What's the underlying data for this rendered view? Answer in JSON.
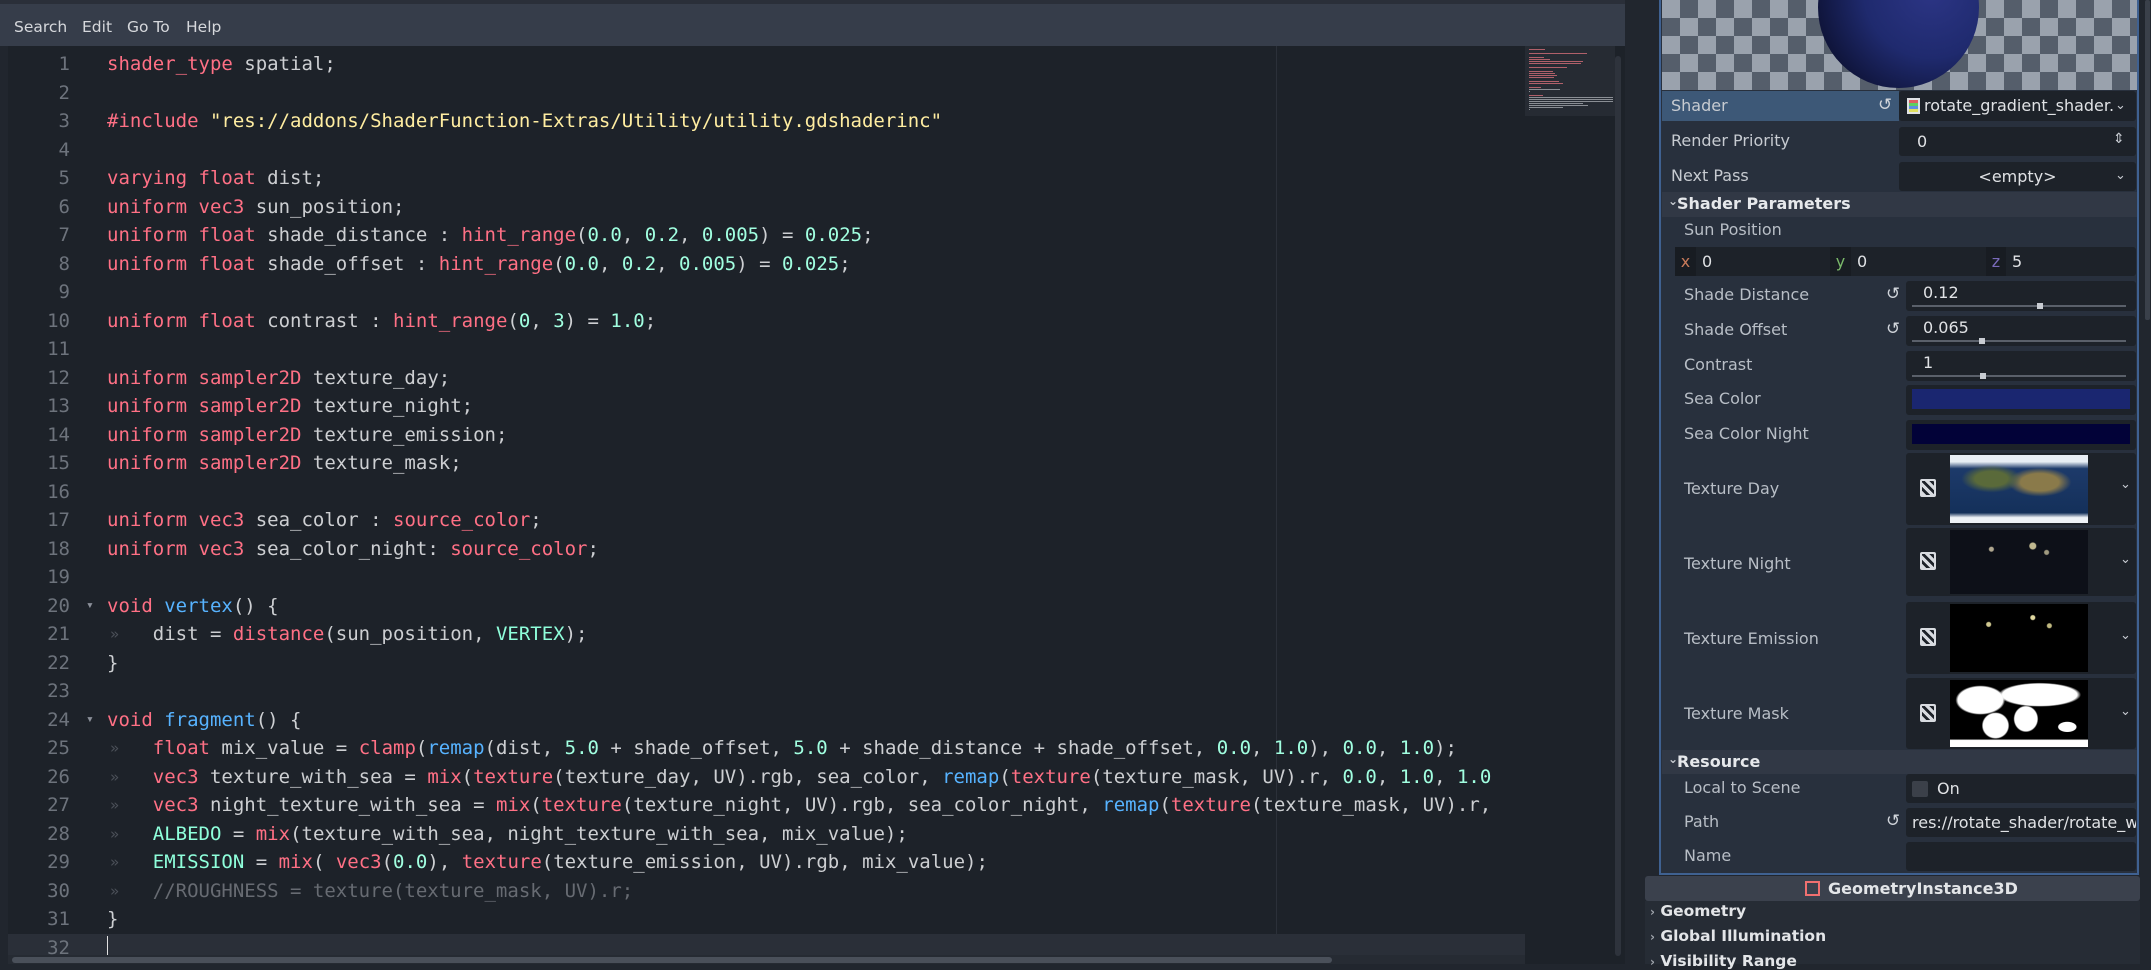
{
  "menu": [
    "Search",
    "Edit",
    "Go To",
    "Help"
  ],
  "editor": {
    "current_line": 32,
    "lines": [
      [
        [
          "shader_type",
          "kw"
        ],
        [
          " spatial;",
          ""
        ]
      ],
      [],
      [
        [
          "#include",
          "kw"
        ],
        [
          " ",
          ""
        ],
        [
          "\"res://addons/ShaderFunction-Extras/Utility/utility.gdshaderinc\"",
          "str"
        ]
      ],
      [],
      [
        [
          "varying",
          "kw"
        ],
        [
          " ",
          ""
        ],
        [
          "float",
          "kw"
        ],
        [
          " dist;",
          ""
        ]
      ],
      [
        [
          "uniform",
          "kw"
        ],
        [
          " ",
          ""
        ],
        [
          "vec3",
          "kw"
        ],
        [
          " sun_position;",
          ""
        ]
      ],
      [
        [
          "uniform",
          "kw"
        ],
        [
          " ",
          ""
        ],
        [
          "float",
          "kw"
        ],
        [
          " shade_distance : ",
          ""
        ],
        [
          "hint_range",
          "kw"
        ],
        [
          "(",
          ""
        ],
        [
          "0.0",
          "num"
        ],
        [
          ", ",
          ""
        ],
        [
          "0.2",
          "num"
        ],
        [
          ", ",
          ""
        ],
        [
          "0.005",
          "num"
        ],
        [
          ") = ",
          ""
        ],
        [
          "0.025",
          "num"
        ],
        [
          ";",
          ""
        ]
      ],
      [
        [
          "uniform",
          "kw"
        ],
        [
          " ",
          ""
        ],
        [
          "float",
          "kw"
        ],
        [
          " shade_offset : ",
          ""
        ],
        [
          "hint_range",
          "kw"
        ],
        [
          "(",
          ""
        ],
        [
          "0.0",
          "num"
        ],
        [
          ", ",
          ""
        ],
        [
          "0.2",
          "num"
        ],
        [
          ", ",
          ""
        ],
        [
          "0.005",
          "num"
        ],
        [
          ") = ",
          ""
        ],
        [
          "0.025",
          "num"
        ],
        [
          ";",
          ""
        ]
      ],
      [],
      [
        [
          "uniform",
          "kw"
        ],
        [
          " ",
          ""
        ],
        [
          "float",
          "kw"
        ],
        [
          " contrast : ",
          ""
        ],
        [
          "hint_range",
          "kw"
        ],
        [
          "(",
          ""
        ],
        [
          "0",
          "num"
        ],
        [
          ", ",
          ""
        ],
        [
          "3",
          "num"
        ],
        [
          ") = ",
          ""
        ],
        [
          "1.0",
          "num"
        ],
        [
          ";",
          ""
        ]
      ],
      [],
      [
        [
          "uniform",
          "kw"
        ],
        [
          " ",
          ""
        ],
        [
          "sampler2D",
          "kw"
        ],
        [
          " texture_day;",
          ""
        ]
      ],
      [
        [
          "uniform",
          "kw"
        ],
        [
          " ",
          ""
        ],
        [
          "sampler2D",
          "kw"
        ],
        [
          " texture_night;",
          ""
        ]
      ],
      [
        [
          "uniform",
          "kw"
        ],
        [
          " ",
          ""
        ],
        [
          "sampler2D",
          "kw"
        ],
        [
          " texture_emission;",
          ""
        ]
      ],
      [
        [
          "uniform",
          "kw"
        ],
        [
          " ",
          ""
        ],
        [
          "sampler2D",
          "kw"
        ],
        [
          " texture_mask;",
          ""
        ]
      ],
      [],
      [
        [
          "uniform",
          "kw"
        ],
        [
          " ",
          ""
        ],
        [
          "vec3",
          "kw"
        ],
        [
          " sea_color : ",
          ""
        ],
        [
          "source_color",
          "kw"
        ],
        [
          ";",
          ""
        ]
      ],
      [
        [
          "uniform",
          "kw"
        ],
        [
          " ",
          ""
        ],
        [
          "vec3",
          "kw"
        ],
        [
          " sea_color_night: ",
          ""
        ],
        [
          "source_color",
          "kw"
        ],
        [
          ";",
          ""
        ]
      ],
      [],
      [
        [
          "void",
          "kw"
        ],
        [
          " ",
          ""
        ],
        [
          "vertex",
          "fn"
        ],
        [
          "() {",
          ""
        ]
      ],
      [
        [
          "\t",
          ""
        ],
        [
          "dist = ",
          ""
        ],
        [
          "distance",
          "kw"
        ],
        [
          "(sun_position, ",
          ""
        ],
        [
          "VERTEX",
          "bi"
        ],
        [
          ");",
          ""
        ]
      ],
      [
        [
          "}",
          ""
        ]
      ],
      [],
      [
        [
          "void",
          "kw"
        ],
        [
          " ",
          ""
        ],
        [
          "fragment",
          "fn"
        ],
        [
          "() {",
          ""
        ]
      ],
      [
        [
          "\t",
          ""
        ],
        [
          "float",
          "kw"
        ],
        [
          " mix_value = ",
          ""
        ],
        [
          "clamp",
          "kw"
        ],
        [
          "(",
          ""
        ],
        [
          "remap",
          "fn"
        ],
        [
          "(dist, ",
          ""
        ],
        [
          "5.0",
          "num"
        ],
        [
          " + shade_offset, ",
          ""
        ],
        [
          "5.0",
          "num"
        ],
        [
          " + shade_distance + shade_offset, ",
          ""
        ],
        [
          "0.0",
          "num"
        ],
        [
          ", ",
          ""
        ],
        [
          "1.0",
          "num"
        ],
        [
          "), ",
          ""
        ],
        [
          "0.0",
          "num"
        ],
        [
          ", ",
          ""
        ],
        [
          "1.0",
          "num"
        ],
        [
          ");",
          ""
        ]
      ],
      [
        [
          "\t",
          ""
        ],
        [
          "vec3",
          "kw"
        ],
        [
          " texture_with_sea = ",
          ""
        ],
        [
          "mix",
          "kw"
        ],
        [
          "(",
          ""
        ],
        [
          "texture",
          "kw"
        ],
        [
          "(texture_day, UV).rgb, sea_color, ",
          ""
        ],
        [
          "remap",
          "fn"
        ],
        [
          "(",
          ""
        ],
        [
          "texture",
          "kw"
        ],
        [
          "(texture_mask, UV).r, ",
          ""
        ],
        [
          "0.0",
          "num"
        ],
        [
          ", ",
          ""
        ],
        [
          "1.0",
          "num"
        ],
        [
          ", ",
          ""
        ],
        [
          "1.0",
          "num"
        ]
      ],
      [
        [
          "\t",
          ""
        ],
        [
          "vec3",
          "kw"
        ],
        [
          " night_texture_with_sea = ",
          ""
        ],
        [
          "mix",
          "kw"
        ],
        [
          "(",
          ""
        ],
        [
          "texture",
          "kw"
        ],
        [
          "(texture_night, UV).rgb, sea_color_night, ",
          ""
        ],
        [
          "remap",
          "fn"
        ],
        [
          "(",
          ""
        ],
        [
          "texture",
          "kw"
        ],
        [
          "(texture_mask, UV).r,",
          ""
        ]
      ],
      [
        [
          "\t",
          ""
        ],
        [
          "ALBEDO",
          "bi"
        ],
        [
          " = ",
          ""
        ],
        [
          "mix",
          "kw"
        ],
        [
          "(texture_with_sea, night_texture_with_sea, mix_value);",
          ""
        ]
      ],
      [
        [
          "\t",
          ""
        ],
        [
          "EMISSION",
          "bi"
        ],
        [
          " = ",
          ""
        ],
        [
          "mix",
          "kw"
        ],
        [
          "( ",
          ""
        ],
        [
          "vec3",
          "kw"
        ],
        [
          "(",
          ""
        ],
        [
          "0.0",
          "num"
        ],
        [
          "), ",
          ""
        ],
        [
          "texture",
          "kw"
        ],
        [
          "(texture_emission, UV).rgb, mix_value);",
          ""
        ]
      ],
      [
        [
          "\t",
          ""
        ],
        [
          "//ROUGHNESS = texture(texture_mask, UV).r;",
          "com"
        ]
      ],
      [
        [
          "}",
          ""
        ]
      ],
      []
    ],
    "foldable_lines": [
      20,
      24
    ]
  },
  "inspector": {
    "shader": {
      "label": "Shader",
      "value": "rotate_gradient_shader."
    },
    "render_priority": {
      "label": "Render Priority",
      "value": "0"
    },
    "next_pass": {
      "label": "Next Pass",
      "value": "<empty>"
    },
    "shader_parameters": {
      "title": "Shader Parameters",
      "sun_position": {
        "label": "Sun Position",
        "x": "0",
        "y": "0",
        "z": "5",
        "x_label": "x",
        "y_label": "y",
        "z_label": "z"
      },
      "shade_distance": {
        "label": "Shade Distance",
        "value": "0.12",
        "fraction": 0.6
      },
      "shade_offset": {
        "label": "Shade Offset",
        "value": "0.065",
        "fraction": 0.325
      },
      "contrast": {
        "label": "Contrast",
        "value": "1",
        "fraction": 0.333
      },
      "sea_color": {
        "label": "Sea Color",
        "color": "#1a2670"
      },
      "sea_color_night": {
        "label": "Sea Color Night",
        "color": "#020238"
      },
      "texture_day": {
        "label": "Texture Day"
      },
      "texture_night": {
        "label": "Texture Night"
      },
      "texture_emission": {
        "label": "Texture Emission"
      },
      "texture_mask": {
        "label": "Texture Mask"
      }
    },
    "resource": {
      "title": "Resource",
      "local_to_scene": {
        "label": "Local to Scene",
        "value": "On",
        "checked": false
      },
      "path": {
        "label": "Path",
        "value": "res://rotate_shader/rotate_w"
      },
      "name": {
        "label": "Name",
        "value": ""
      }
    },
    "geometry_instance": {
      "title": "GeometryInstance3D",
      "sections": [
        "Geometry",
        "Global Illumination",
        "Visibility Range"
      ]
    }
  }
}
